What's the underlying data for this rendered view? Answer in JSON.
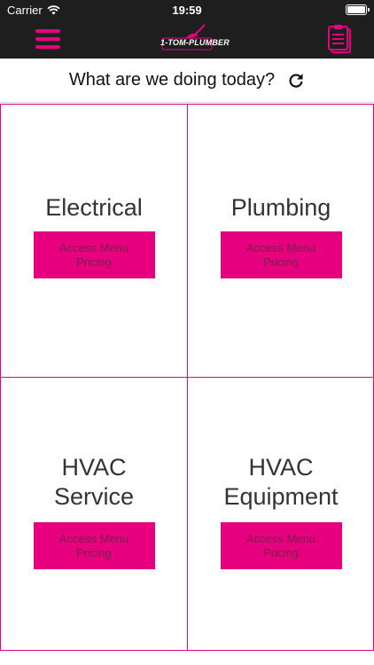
{
  "status_bar": {
    "carrier": "Carrier",
    "time": "19:59"
  },
  "nav": {
    "logo_text": "1-TOM-PLUMBER"
  },
  "header": {
    "question": "What are we doing today?"
  },
  "tiles": [
    {
      "title": "Electrical",
      "button_label": "Access Menu Pricing"
    },
    {
      "title": "Plumbing",
      "button_label": "Access Menu Pricing"
    },
    {
      "title": "HVAC\nService",
      "button_label": "Access Menu Pricing"
    },
    {
      "title": "HVAC\nEquipment",
      "button_label": "Access Menu Pricing"
    }
  ],
  "colors": {
    "accent": "#e6007e",
    "topbar": "#1e1e1e",
    "button_text": "#7a1f4f"
  },
  "icons": [
    "wifi-icon",
    "battery-icon",
    "menu-icon",
    "plunger-logo-icon",
    "clipboard-icon",
    "refresh-icon"
  ]
}
